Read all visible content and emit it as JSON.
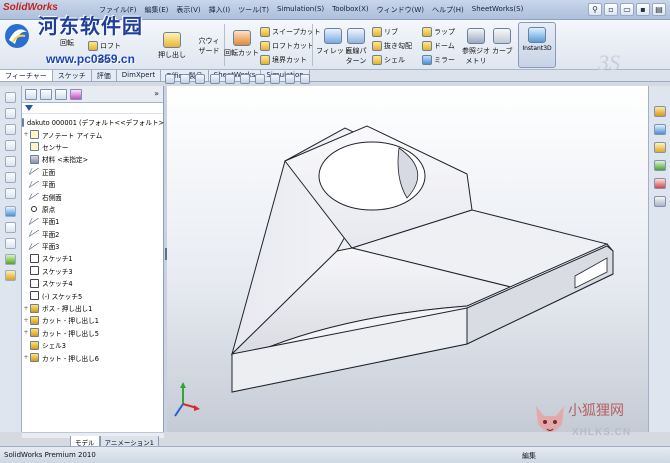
{
  "window": {
    "app_logo": "SolidWorks",
    "menu": [
      "ファイル(F)",
      "編集(E)",
      "表示(V)",
      "挿入(I)",
      "ツール(T)",
      "Simulation(S)",
      "Toolbox(X)",
      "ウィンドウ(W)",
      "ヘルプ(H)",
      "SheetWorks(S)"
    ]
  },
  "watermark": {
    "site_name": "河东软件园",
    "site_url": "www.pc0359.cn",
    "badge_title": "小狐狸网",
    "badge_url": "XHLKS.CN"
  },
  "ribbon": {
    "boss_extrude": "押し出し",
    "boss_revolve": "回転",
    "loft": "ロフト",
    "boundary": "境界",
    "wizard": "穴ウィザード",
    "revolve_cut": "回転カット",
    "sweep_cut": "スイープカット",
    "loft_cut": "ロフトカット",
    "boundary_cut": "境界カット",
    "fillet": "フィレット",
    "linear_pattern": "直線パターン",
    "rib": "リブ",
    "draft": "抜き勾配",
    "shell": "シェル",
    "wrap": "ラップ",
    "dome": "ドーム",
    "mirror": "ミラー",
    "reference_geometry": "参照ジオメトリ",
    "curves": "カーブ",
    "instant3d": "Instant3D"
  },
  "command_tabs": [
    "フィーチャー",
    "スケッチ",
    "評価",
    "DimXpert",
    "Office 製品",
    "SheetWorks",
    "Simulation"
  ],
  "feature_tree": {
    "expand_label": "»",
    "root": "dakuto 000001 (デフォルト<<デフォルト>",
    "items": [
      {
        "label": "アノテート アイテム",
        "icon": "annotation-icon",
        "expand": "+"
      },
      {
        "label": "センサー",
        "icon": "sensor-icon",
        "expand": ""
      },
      {
        "label": "材料 <未指定>",
        "icon": "material-icon",
        "expand": ""
      },
      {
        "label": "正面",
        "icon": "plane-icon",
        "expand": ""
      },
      {
        "label": "平面",
        "icon": "plane-icon",
        "expand": ""
      },
      {
        "label": "右側面",
        "icon": "plane-icon",
        "expand": ""
      },
      {
        "label": "原点",
        "icon": "origin-icon",
        "expand": ""
      },
      {
        "label": "平面1",
        "icon": "plane-icon",
        "expand": ""
      },
      {
        "label": "平面2",
        "icon": "plane-icon",
        "expand": ""
      },
      {
        "label": "平面3",
        "icon": "plane-icon",
        "expand": ""
      },
      {
        "label": "スケッチ1",
        "icon": "sketch-icon",
        "expand": ""
      },
      {
        "label": "スケッチ3",
        "icon": "sketch-icon",
        "expand": ""
      },
      {
        "label": "スケッチ4",
        "icon": "sketch-icon",
        "expand": ""
      },
      {
        "label": "(-) スケッチ5",
        "icon": "sketch-icon",
        "expand": ""
      },
      {
        "label": "ボス - 押し出し1",
        "icon": "boss-extrude-icon",
        "expand": "+"
      },
      {
        "label": "カット - 押し出し1",
        "icon": "cut-extrude-icon",
        "expand": "+"
      },
      {
        "label": "カット - 押し出し5",
        "icon": "cut-extrude-icon",
        "expand": "+"
      },
      {
        "label": "シェル3",
        "icon": "shell-icon",
        "expand": ""
      },
      {
        "label": "カット - 押し出し6",
        "icon": "cut-extrude-icon",
        "expand": "+"
      }
    ]
  },
  "bottom_tabs": [
    "モデル",
    "アニメーション1"
  ],
  "status": {
    "left": "SolidWorks Premium 2010",
    "right": "編集"
  },
  "colors": {
    "model_face": "#f3f3f6",
    "model_shadow": "#cdd0d8",
    "model_edge": "#20242c",
    "viewport_top": "#ffffff",
    "viewport_bottom": "#c5cbd5"
  }
}
